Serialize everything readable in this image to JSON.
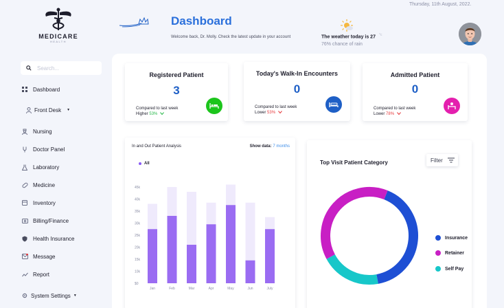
{
  "brand": {
    "name": "MEDICARE",
    "tagline": "HEALTH"
  },
  "search": {
    "placeholder": "Search..."
  },
  "sidebar": {
    "items": [
      {
        "label": "Dashboard",
        "icon": "grid-icon"
      },
      {
        "label": "Front Desk",
        "icon": "person-icon"
      },
      {
        "label": "Nursing",
        "icon": "nurse-icon"
      },
      {
        "label": "Doctor Panel",
        "icon": "stethoscope-icon"
      },
      {
        "label": "Laboratory",
        "icon": "flask-icon"
      },
      {
        "label": "Medicine",
        "icon": "pill-icon"
      },
      {
        "label": "Inventory",
        "icon": "box-icon"
      },
      {
        "label": "Billing/Finance",
        "icon": "money-icon"
      },
      {
        "label": "Health Insurance",
        "icon": "shield-icon"
      },
      {
        "label": "Message",
        "icon": "message-icon"
      },
      {
        "label": "Report",
        "icon": "trend-icon"
      },
      {
        "label": "System Settings",
        "icon": "gear-icon"
      }
    ]
  },
  "header": {
    "title": "Dashboard",
    "subtitle": "Welcome back, Dr. Molly. Check the latest update in your account",
    "date": "Thursday, 11th August, 2022.",
    "weather": "The weather today is 27",
    "weather_unit": "°c",
    "rain": "76% chance of rain"
  },
  "cards": [
    {
      "title": "Registered Patient",
      "value": "3",
      "compare": "Compared to last week",
      "trend_word": "Higher",
      "trend_pct": "53%",
      "trend": "up",
      "icon_color": "#1cc51c",
      "icon": "bed-icon"
    },
    {
      "title": "Today's Walk-In Encounters",
      "value": "0",
      "compare": "Compared to last week",
      "trend_word": "Lower",
      "trend_pct": "53%",
      "trend": "down",
      "icon_color": "#1e5fc6",
      "icon": "hospital-bed-icon"
    },
    {
      "title": "Admitted Patient",
      "value": "0",
      "compare": "Compared to last week",
      "trend_word": "Lower",
      "trend_pct": "78%",
      "trend": "down",
      "icon_color": "#e41fae",
      "icon": "patient-bed-icon"
    }
  ],
  "bar_panel": {
    "title": "In and Out Patient Analysis",
    "show_label": "Show data:",
    "show_value": "7 months",
    "legend": "All"
  },
  "donut_panel": {
    "title": "Top Visit Patient Category",
    "filter_label": "Filter"
  },
  "colors": {
    "bar_fore": "#9a6cf2",
    "bar_back": "#efeafc",
    "insurance": "#1e4fd4",
    "retainer": "#c81fc4",
    "self_pay": "#17c7c9"
  },
  "chart_data": [
    {
      "type": "bar",
      "categories": [
        "Jan",
        "Feb",
        "Mar",
        "Apr",
        "May",
        "Jun",
        "July"
      ],
      "y_ticks": [
        "$0",
        "10k",
        "15k",
        "20k",
        "25k",
        "30k",
        "35k",
        "40k",
        "45k"
      ],
      "series": [
        {
          "values": [
            27500,
            33000,
            21000,
            29500,
            37500,
            14500,
            27500
          ]
        },
        {
          "values": [
            38000,
            45000,
            43000,
            38500,
            46000,
            38500,
            32500
          ]
        }
      ]
    },
    {
      "type": "pie",
      "labels": [
        "Insurance",
        "Retainer",
        "Self Pay"
      ],
      "values": [
        41,
        39,
        20
      ]
    }
  ]
}
